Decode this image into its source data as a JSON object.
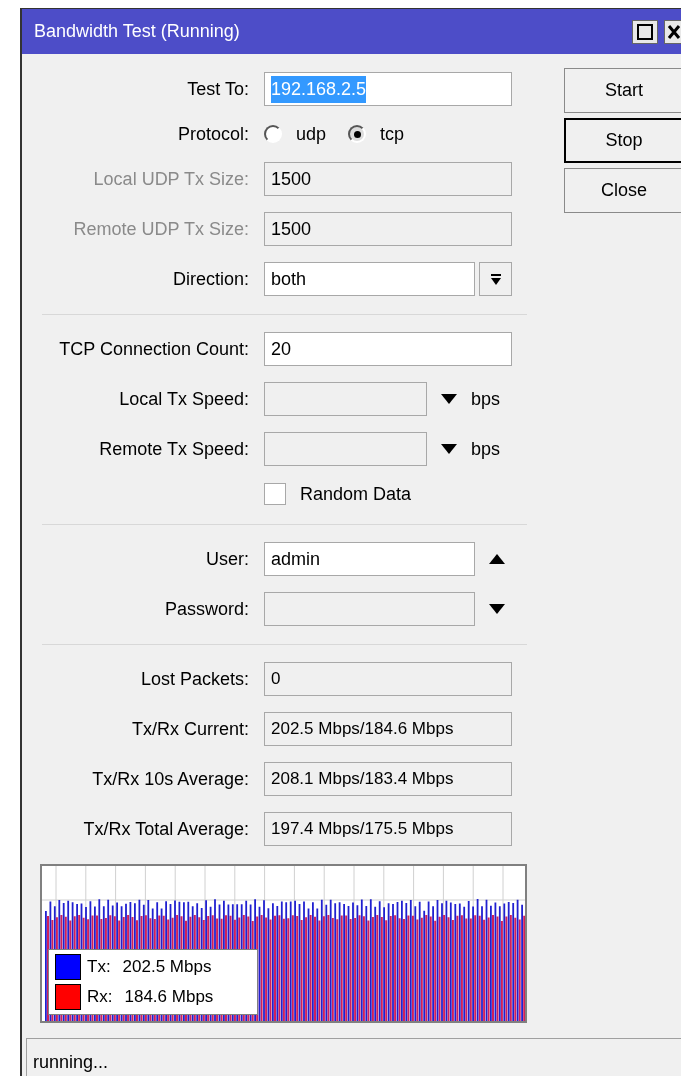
{
  "window": {
    "title": "Bandwidth Test (Running)"
  },
  "form": [
    {
      "kind": "text",
      "label": "Test To:",
      "value": "192.168.2.5",
      "disabled": false,
      "text_selected": true
    },
    {
      "kind": "radio",
      "label": "Protocol:",
      "options": [
        {
          "label": "udp",
          "selected": false
        },
        {
          "label": "tcp",
          "selected": true
        }
      ]
    },
    {
      "kind": "text",
      "label": "Local UDP Tx Size:",
      "value": "1500",
      "disabled": true,
      "text_selected": false
    },
    {
      "kind": "text",
      "label": "Remote UDP Tx Size:",
      "value": "1500",
      "disabled": true,
      "text_selected": false
    },
    {
      "kind": "dropdown",
      "label": "Direction:",
      "value": "both"
    },
    {
      "kind": "separator"
    },
    {
      "kind": "text",
      "label": "TCP Connection Count:",
      "value": "20",
      "disabled": false,
      "text_selected": false
    },
    {
      "kind": "speed",
      "label": "Local Tx Speed:",
      "unit": "bps"
    },
    {
      "kind": "speed",
      "label": "Remote Tx Speed:",
      "unit": "bps"
    },
    {
      "kind": "checkbox",
      "label": "Random Data",
      "checked": false
    },
    {
      "kind": "separator"
    },
    {
      "kind": "toggle_field",
      "label": "User:",
      "value": "admin",
      "expanded": true
    },
    {
      "kind": "toggle_field",
      "label": "Password:",
      "expanded": false
    },
    {
      "kind": "separator"
    },
    {
      "kind": "readout",
      "label": "Lost Packets:",
      "value": "0"
    },
    {
      "kind": "readout",
      "label": "Tx/Rx Current:",
      "value": "202.5 Mbps/184.6 Mbps"
    },
    {
      "kind": "readout",
      "label": "Tx/Rx 10s Average:",
      "value": "208.1 Mbps/183.4 Mbps"
    },
    {
      "kind": "readout",
      "label": "Tx/Rx Total Average:",
      "value": "197.4 Mbps/175.5 Mbps"
    }
  ],
  "buttons": [
    {
      "label": "Start",
      "focused": false
    },
    {
      "label": "Stop",
      "focused": true
    },
    {
      "label": "Close",
      "focused": false
    }
  ],
  "graph": {
    "legend": [
      {
        "label": "Tx:",
        "value": "202.5 Mbps",
        "color": "#0000ff"
      },
      {
        "label": "Rx:",
        "value": "184.6 Mbps",
        "color": "#ff0000"
      }
    ]
  },
  "status_bar": {
    "text": "running..."
  }
}
